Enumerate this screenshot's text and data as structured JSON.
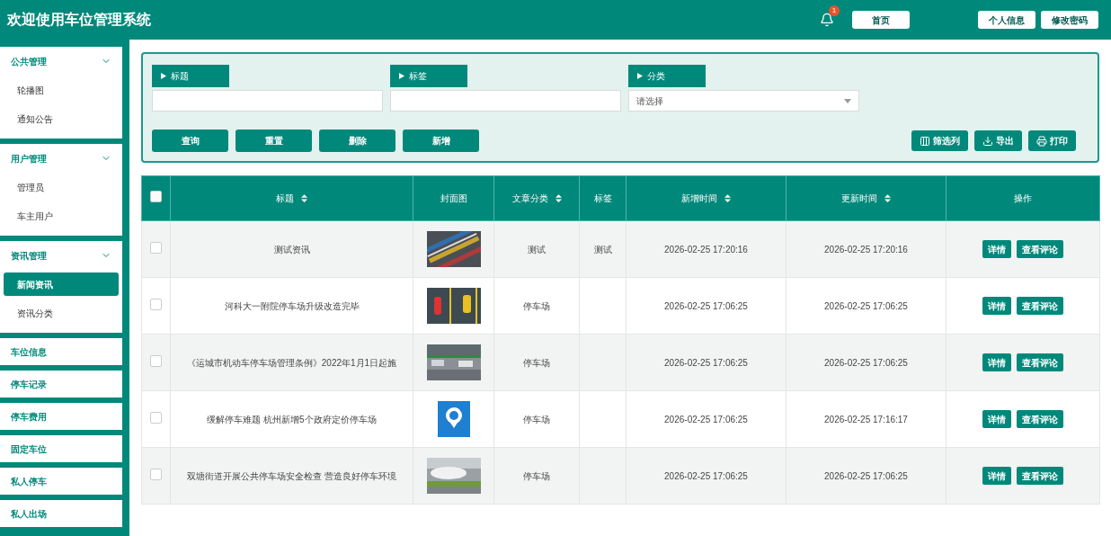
{
  "header": {
    "title": "欢迎使用车位管理系统",
    "notification_count": "1",
    "nav_buttons": [
      "首页",
      "个人信息",
      "修改密码"
    ]
  },
  "sidebar": [
    {
      "label": "公共管理",
      "kind": "group",
      "expanded": true,
      "children": [
        {
          "label": "轮播图",
          "selected": false
        },
        {
          "label": "通知公告",
          "selected": false
        }
      ]
    },
    {
      "label": "用户管理",
      "kind": "group",
      "expanded": true,
      "children": [
        {
          "label": "管理员",
          "selected": false
        },
        {
          "label": "车主用户",
          "selected": false
        }
      ]
    },
    {
      "label": "资讯管理",
      "kind": "group",
      "expanded": true,
      "children": [
        {
          "label": "新闻资讯",
          "selected": true
        },
        {
          "label": "资讯分类",
          "selected": false
        }
      ]
    },
    {
      "label": "车位信息",
      "kind": "item"
    },
    {
      "label": "停车记录",
      "kind": "item"
    },
    {
      "label": "停车费用",
      "kind": "item"
    },
    {
      "label": "固定车位",
      "kind": "item"
    },
    {
      "label": "私人停车",
      "kind": "item"
    },
    {
      "label": "私人出场",
      "kind": "item"
    }
  ],
  "filters": [
    {
      "label": "标题",
      "kind": "text"
    },
    {
      "label": "标签",
      "kind": "text"
    },
    {
      "label": "分类",
      "kind": "select",
      "placeholder": "请选择"
    }
  ],
  "actions": [
    "查询",
    "重置",
    "删除",
    "新增"
  ],
  "tools": [
    {
      "label": "筛选列",
      "kind": "columns"
    },
    {
      "label": "导出",
      "kind": "export"
    },
    {
      "label": "打印",
      "kind": "print"
    }
  ],
  "table": {
    "select_all": false,
    "columns": [
      {
        "label": "标题",
        "sortable": true
      },
      {
        "label": "封面图",
        "sortable": false
      },
      {
        "label": "文章分类",
        "sortable": true
      },
      {
        "label": "标签",
        "sortable": false
      },
      {
        "label": "新增时间",
        "sortable": true
      },
      {
        "label": "更新时间",
        "sortable": true
      },
      {
        "label": "操作",
        "sortable": false
      }
    ],
    "rows": [
      {
        "checked": false,
        "title": "测试资讯",
        "cover": {
          "kind": "picture"
        },
        "category": "测试",
        "tag": "测试",
        "created": "2026-02-25 17:20:16",
        "updated": "2026-02-25 17:20:16",
        "buttons": [
          "详情",
          "查看评论"
        ]
      },
      {
        "checked": false,
        "title": "河科大一附院停车场升级改造完毕",
        "cover": {
          "kind": "picture"
        },
        "category": "停车场",
        "created": "2026-02-25 17:06:25",
        "updated": "2026-02-25 17:06:25",
        "buttons": [
          "详情",
          "查看评论"
        ]
      },
      {
        "checked": false,
        "title": "《运城市机动车停车场管理条例》2022年1月1日起施",
        "cover": {
          "kind": "picture"
        },
        "category": "停车场",
        "created": "2026-02-25 17:06:25",
        "updated": "2026-02-25 17:06:25",
        "buttons": [
          "详情",
          "查看评论"
        ]
      },
      {
        "checked": false,
        "title": "缓解停车难题 杭州新增5个政府定价停车场",
        "cover": {
          "kind": "picture"
        },
        "category": "停车场",
        "created": "2026-02-25 17:06:25",
        "updated": "2026-02-25 17:16:17",
        "buttons": [
          "详情",
          "查看评论"
        ]
      },
      {
        "checked": false,
        "title": "双塘街道开展公共停车场安全检查 营造良好停车环境",
        "cover": {
          "kind": "picture"
        },
        "category": "停车场",
        "created": "2026-02-25 17:06:25",
        "updated": "2026-02-25 17:06:25",
        "buttons": [
          "详情",
          "查看评论"
        ]
      }
    ]
  }
}
